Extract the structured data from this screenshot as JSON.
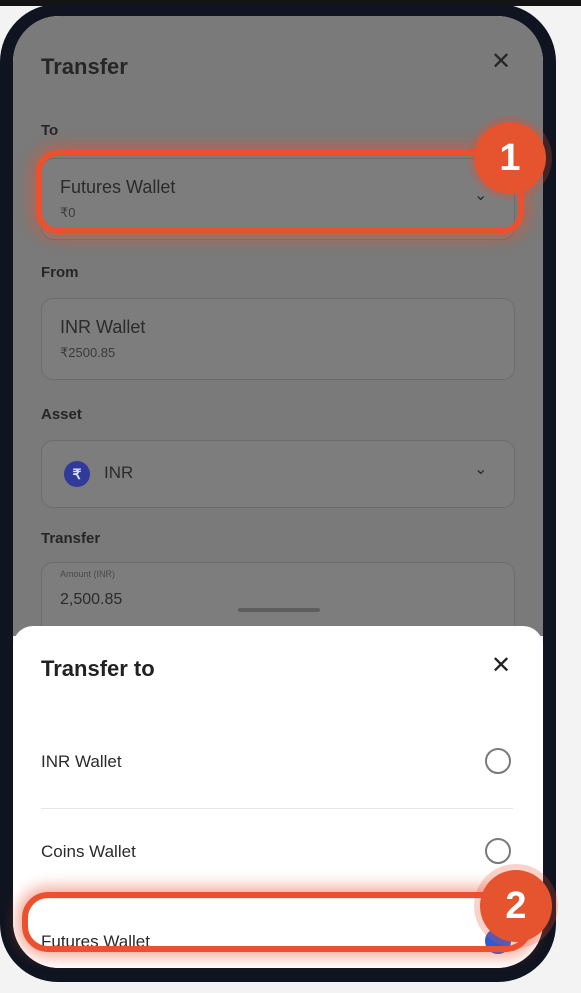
{
  "dialog": {
    "title": "Transfer",
    "to_label": "To",
    "to_value": "Futures Wallet",
    "to_balance": "₹0",
    "from_label": "From",
    "from_value": "INR Wallet",
    "from_balance": "₹2500.85",
    "asset_label": "Asset",
    "asset_icon_letter": "₹",
    "asset_value": "INR",
    "transfer_label": "Transfer",
    "amount_placeholder": "Amount (INR)",
    "amount_value": "2,500.85"
  },
  "sheet": {
    "title": "Transfer to",
    "options": [
      {
        "label": "INR Wallet",
        "selected": false
      },
      {
        "label": "Coins Wallet",
        "selected": false
      },
      {
        "label": "Futures Wallet",
        "selected": true
      }
    ]
  },
  "annotations": {
    "step1": "1",
    "step2": "2",
    "highlight_color": "#e9512f"
  }
}
